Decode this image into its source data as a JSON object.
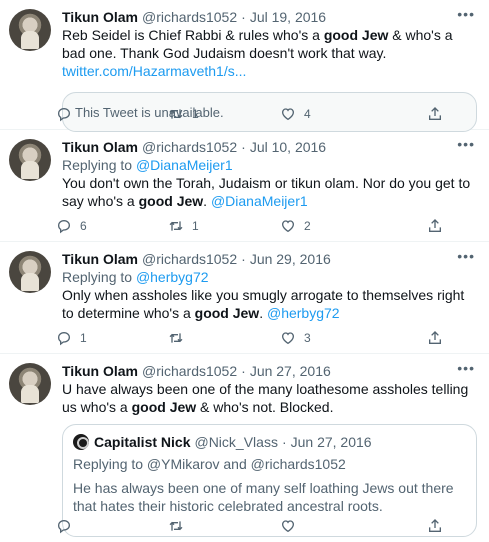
{
  "tweets": [
    {
      "name": "Tikun Olam",
      "handle": "@richards1052",
      "date": "Jul 19, 2016",
      "text_a": "Reb Seidel is Chief Rabbi & rules who's a ",
      "bold": "good Jew",
      "text_b": " & who's a bad one. Thank God Judaism doesn't work that way. ",
      "link": "twitter.com/Hazarmaveth1/s...",
      "unavailable": "This Tweet is unavailable.",
      "retweets": "1",
      "likes": "4"
    },
    {
      "name": "Tikun Olam",
      "handle": "@richards1052",
      "date": "Jul 10, 2016",
      "replying_label": "Replying to ",
      "replying_to": "@DianaMeijer1",
      "text_a": "You don't own the Torah, Judaism or tikun olam. Nor do you get to say who's a ",
      "bold": "good Jew",
      "text_b": ". ",
      "mention": "@DianaMeijer1",
      "replies": "6",
      "retweets": "1",
      "likes": "2"
    },
    {
      "name": "Tikun Olam",
      "handle": "@richards1052",
      "date": "Jun 29, 2016",
      "replying_label": "Replying to ",
      "replying_to": "@herbyg72",
      "text_a": "Only when assholes like you smugly arrogate to themselves right to determine who's a ",
      "bold": "good Jew",
      "text_b": ". ",
      "mention": "@herbyg72",
      "replies": "1",
      "retweets": "",
      "likes": "3"
    },
    {
      "name": "Tikun Olam",
      "handle": "@richards1052",
      "date": "Jun 27, 2016",
      "text_a": "U have always been one of the many loathesome assholes telling us who's a ",
      "bold": "good Jew",
      "text_b": " & who's not. Blocked.",
      "quote": {
        "name": "Capitalist Nick",
        "handle": "@Nick_Vlass",
        "date": "Jun 27, 2016",
        "replying": "Replying to @YMikarov and @richards1052",
        "text": "He has always been one of many self loathing Jews out there that hates their historic celebrated ancestral roots."
      }
    }
  ],
  "separator": "·",
  "more": "•••",
  "icons": [
    "reply-icon",
    "retweet-icon",
    "like-icon",
    "share-icon",
    "more-icon"
  ],
  "colors": {
    "link": "#1d9bf0",
    "muted": "#536471",
    "text": "#0f1419",
    "border": "#cfd9de"
  }
}
